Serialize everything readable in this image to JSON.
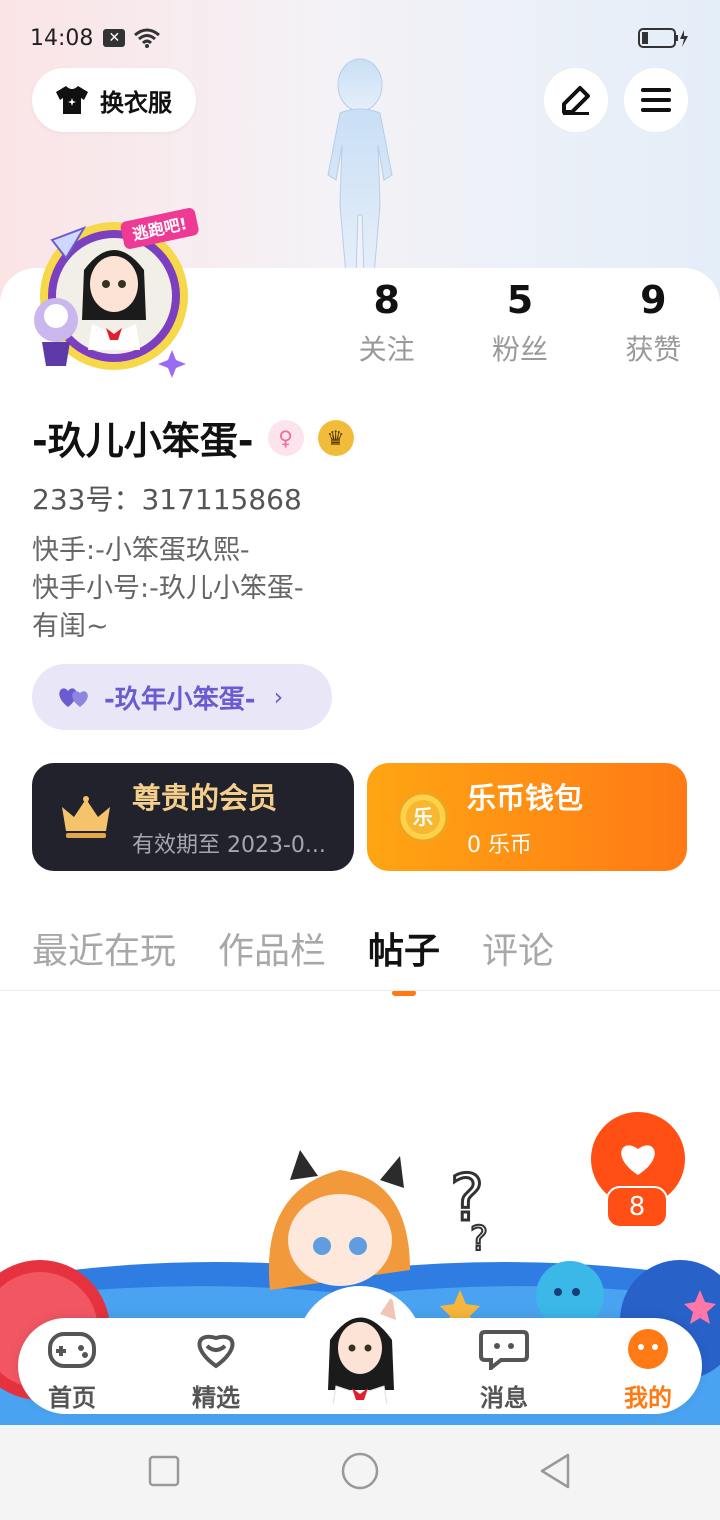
{
  "status_bar": {
    "time": "14:08"
  },
  "header": {
    "outfit_label": "换衣服"
  },
  "stats": [
    {
      "value": "8",
      "label": "关注"
    },
    {
      "value": "5",
      "label": "粉丝"
    },
    {
      "value": "9",
      "label": "获赞"
    }
  ],
  "profile": {
    "name": "-玖儿小笨蛋-",
    "uid": "233号：317115868",
    "bio": [
      "快手:-小笨蛋玖熙-",
      "快手小号:-玖儿小笨蛋-",
      "有闺~"
    ],
    "avatar_sticker": "逃跑吧!"
  },
  "fan_tag": {
    "label": "-玖年小笨蛋-"
  },
  "member_card": {
    "title": "尊贵的会员",
    "subtitle": "有效期至 2023-0..."
  },
  "wallet_card": {
    "title": "乐币钱包",
    "subtitle": "0 乐币",
    "coin_glyph": "乐"
  },
  "tabs": [
    {
      "label": "最近在玩",
      "active": false
    },
    {
      "label": "作品栏",
      "active": false
    },
    {
      "label": "帖子",
      "active": true
    },
    {
      "label": "评论",
      "active": false
    }
  ],
  "like": {
    "count": "8"
  },
  "bottom_nav": [
    {
      "label": "首页",
      "icon": "gamepad-icon"
    },
    {
      "label": "精选",
      "icon": "heart-chat-icon"
    },
    {
      "label": "消息",
      "icon": "message-icon"
    },
    {
      "label": "我的",
      "icon": "me-face-icon",
      "active": true
    }
  ],
  "colors": {
    "accent": "#ff7a14",
    "like": "#ff4f14",
    "member_bg": "#22222c",
    "fan_tag_bg": "#e9e7f7"
  }
}
